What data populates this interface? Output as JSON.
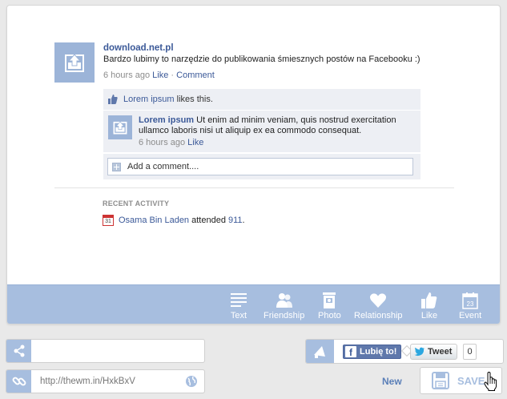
{
  "post": {
    "title": "download.net.pl",
    "text": "Bardzo lubimy to narzędzie do publikowania śmiesznych postów na Facebooku :)",
    "time": "6 hours ago",
    "like_label": "Like",
    "separator": " · ",
    "comment_label": "Comment"
  },
  "likes": {
    "name": "Lorem ipsum",
    "suffix": " likes this."
  },
  "comment": {
    "author": "Lorem ipsum",
    "text": " Ut enim ad minim veniam, quis nostrud exercitation ullamco laboris nisi ut aliquip ex ea commodo consequat.",
    "time": "6 hours ago",
    "like_label": "Like"
  },
  "add_comment": {
    "placeholder": "Add a comment...."
  },
  "recent_activity": {
    "heading": "RECENT ACTIVITY",
    "calendar_day": "31",
    "person": "Osama Bin Laden",
    "verb": " attended ",
    "event": "911",
    "end": "."
  },
  "toolbar": {
    "items": [
      {
        "label": "Text",
        "icon": "text-icon"
      },
      {
        "label": "Friendship",
        "icon": "friendship-icon"
      },
      {
        "label": "Photo",
        "icon": "photo-icon"
      },
      {
        "label": "Relationship",
        "icon": "heart-icon"
      },
      {
        "label": "Like",
        "icon": "thumbs-up-icon"
      },
      {
        "label": "Event",
        "icon": "calendar-icon"
      }
    ],
    "calendar_day": "23"
  },
  "share": {
    "input_value": ""
  },
  "url": {
    "value": "http://thewm.in/HxkBxV"
  },
  "social": {
    "fb_like_label": "Lubię to!",
    "tweet_label": "Tweet",
    "tweet_count": "0"
  },
  "actions": {
    "new_label": "New",
    "save_label": "SAVE"
  },
  "colors": {
    "accent": "#a7bedf",
    "link": "#3b5998",
    "panel": "#edeff4"
  }
}
